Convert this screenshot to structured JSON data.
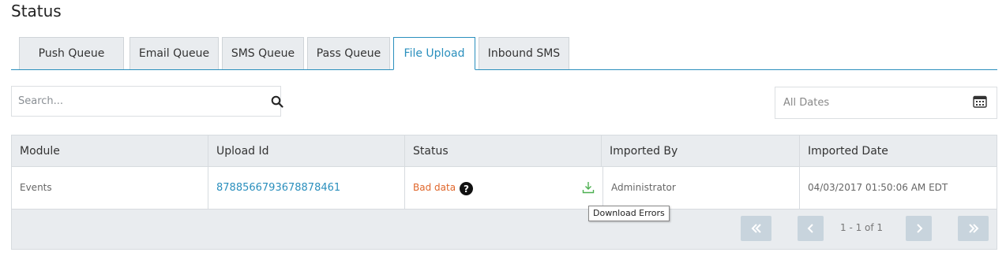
{
  "page": {
    "title": "Status"
  },
  "tabs": [
    {
      "label": "Push  Queue",
      "active": false
    },
    {
      "label": "Email Queue",
      "active": false
    },
    {
      "label": "SMS Queue",
      "active": false
    },
    {
      "label": "Pass Queue",
      "active": false
    },
    {
      "label": "File Upload",
      "active": true
    },
    {
      "label": "Inbound SMS",
      "active": false
    }
  ],
  "search": {
    "placeholder": "Search...",
    "value": "",
    "icon": "search-icon"
  },
  "date_filter": {
    "value": "All Dates",
    "icon": "calendar-icon"
  },
  "table": {
    "columns": [
      "Module",
      "Upload Id",
      "Status",
      "Imported By",
      "Imported Date"
    ],
    "rows": [
      {
        "module": "Events",
        "upload_id": "8788566793678878461",
        "status": "Bad data",
        "imported_by": "Administrator",
        "imported_date": "04/03/2017 01:50:06 AM EDT"
      }
    ]
  },
  "tooltip": {
    "text": "Download Errors"
  },
  "pagination": {
    "text": "1 - 1 of 1"
  },
  "colors": {
    "accent": "#2a8fbd",
    "status_error": "#e0662a",
    "download_icon": "#4caf50",
    "pager_button": "#c8d4dd"
  }
}
